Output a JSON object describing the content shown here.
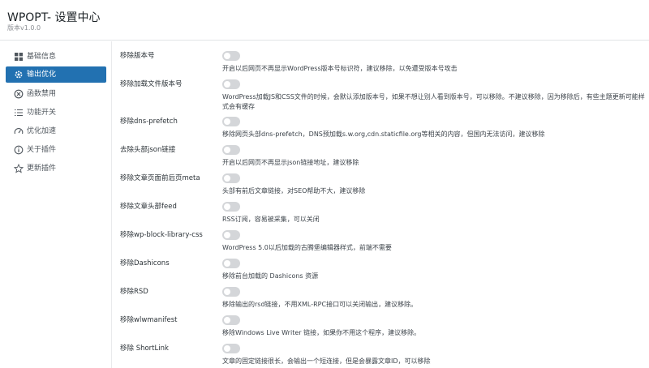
{
  "header": {
    "title": "WPOPT- 设置中心",
    "version": "版本v1.0.0"
  },
  "sidebar": {
    "items": [
      {
        "label": "基础信息",
        "icon": "grid-icon"
      },
      {
        "label": "输出优化",
        "icon": "gear-icon",
        "active": true
      },
      {
        "label": "函数禁用",
        "icon": "block-icon"
      },
      {
        "label": "功能开关",
        "icon": "list-icon"
      },
      {
        "label": "优化加速",
        "icon": "speedometer-icon"
      },
      {
        "label": "关于插件",
        "icon": "info-icon"
      },
      {
        "label": "更新插件",
        "icon": "star-icon"
      }
    ]
  },
  "colors": {
    "accent": "#2271b1",
    "toggle_off": "#d4d6d9"
  },
  "settings": [
    {
      "label": "移除版本号",
      "enabled": false,
      "description": "开启以后网页不再显示WordPress版本号标识符，建议移除，以免遭受版本号攻击"
    },
    {
      "label": "移除加载文件版本号",
      "enabled": false,
      "description": "WordPress加载JS和CSS文件的时候，会默认添加版本号，如果不想让别人看到版本号，可以移除。不建议移除，因为移除后，有些主题更新可能样式会有缓存"
    },
    {
      "label": "移除dns-prefetch",
      "enabled": false,
      "description": "移除网页头部dns-prefetch，DNS预加载s.w.org,cdn.staticfile.org等相关的内容，但国内无法访问，建议移除"
    },
    {
      "label": "去除头部json链接",
      "enabled": false,
      "description": "开启以后网页不再显示json链接地址，建议移除"
    },
    {
      "label": "移除文章页面前后页meta",
      "enabled": false,
      "description": "头部有前后文章链接，对SEO帮助不大，建议移除"
    },
    {
      "label": "移除文章头部feed",
      "enabled": false,
      "description": "RSS订阅，容易被采集，可以关闭"
    },
    {
      "label": "移除wp-block-library-css",
      "enabled": false,
      "description": "WordPress 5.0以后加载的古腾堡编辑器样式，前端不需要"
    },
    {
      "label": "移除Dashicons",
      "enabled": false,
      "description": "移除前台加载的 Dashicons 资源"
    },
    {
      "label": "移除RSD",
      "enabled": false,
      "description": "移除输出的rsd链接，不用XML-RPC接口可以关闭输出，建议移除。"
    },
    {
      "label": "移除wlwmanifest",
      "enabled": false,
      "description": "移除Windows Live Writer 链接，如果你不用这个程序，建议移除。"
    },
    {
      "label": "移除 ShortLink",
      "enabled": false,
      "description": "文章的固定链接很长，会输出一个短连接，但是会暴露文章ID，可以移除"
    }
  ]
}
